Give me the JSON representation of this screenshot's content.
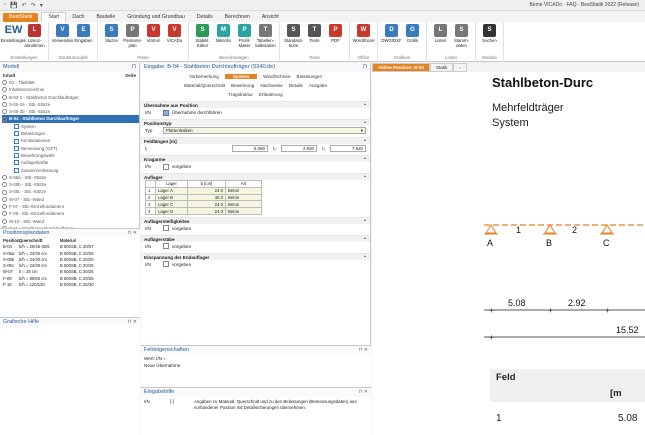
{
  "window": {
    "title": "Beme VICADo · FAQ · BestStatik 2022 (Release)",
    "quick_access": [
      "▫",
      "💾",
      "↶",
      "↷",
      "▾"
    ]
  },
  "tabs": [
    {
      "label": "BestStatik",
      "kind": "file"
    },
    {
      "label": "Start",
      "kind": "active"
    },
    {
      "label": "Dach",
      "kind": ""
    },
    {
      "label": "Bauteile",
      "kind": ""
    },
    {
      "label": "Gründung und Grundbau",
      "kind": ""
    },
    {
      "label": "Details",
      "kind": ""
    },
    {
      "label": "Berechnen",
      "kind": ""
    },
    {
      "label": "Ansicht",
      "kind": ""
    }
  ],
  "ribbon": {
    "groups": [
      {
        "label": "Einstellungen",
        "buttons": [
          {
            "label": "Einstellungen",
            "icon": "ew-logo-icon",
            "color": "#1e5b9a"
          },
          {
            "label": "Lizenz-annahmen",
            "icon": "license-icon",
            "color": "#b33"
          }
        ]
      },
      {
        "label": "Strukturmodell",
        "buttons": [
          {
            "label": "Verwenden",
            "icon": "use-icon",
            "color": "#3a7bbf"
          },
          {
            "label": "Eingaben",
            "icon": "input-icon",
            "color": "#3a7bbf"
          }
        ]
      },
      {
        "label": "Pläne",
        "buttons": [
          {
            "label": "Skizze",
            "icon": "sketch-icon",
            "color": "#3a7bbf"
          },
          {
            "label": "Positions-plan",
            "icon": "position-plan-icon",
            "color": "#777"
          },
          {
            "label": "ViaXon",
            "icon": "viaxon-icon",
            "color": "#c9382c"
          },
          {
            "label": "ViCADo",
            "icon": "vicado-icon",
            "color": "#c9382c"
          }
        ]
      },
      {
        "label": "Berechnungen",
        "buttons": [
          {
            "label": "Stabilit. Editor",
            "icon": "stability-icon",
            "color": "#2e9a57"
          },
          {
            "label": "Mikrofin",
            "icon": "microfin-icon",
            "color": "#2aa3a3"
          },
          {
            "label": "Profil-Maker",
            "icon": "profile-icon",
            "color": "#2aa3a3"
          },
          {
            "label": "Tabellen-kalkulation",
            "icon": "table-icon",
            "color": "#777"
          }
        ]
      },
      {
        "label": "Texte",
        "buttons": [
          {
            "label": "Standard-texte",
            "icon": "text-icon",
            "color": "#555"
          },
          {
            "label": "Texte",
            "icon": "texts-icon",
            "color": "#555"
          },
          {
            "label": "PDF",
            "icon": "pdf-icon",
            "color": "#c9382c"
          }
        ]
      },
      {
        "label": "Office",
        "buttons": [
          {
            "label": "Word/Excel",
            "icon": "word-icon",
            "color": "#c9382c"
          }
        ]
      },
      {
        "label": "Grafiken",
        "buttons": [
          {
            "label": "DWG/DXF",
            "icon": "dwg-icon",
            "color": "#3a7bbf"
          },
          {
            "label": "Grafik",
            "icon": "graphic-icon",
            "color": "#3a7bbf"
          }
        ]
      },
      {
        "label": "Listen",
        "buttons": [
          {
            "label": "Listen",
            "icon": "list-icon",
            "color": "#777"
          },
          {
            "label": "Stamm-daten",
            "icon": "master-data-icon",
            "color": "#777"
          }
        ]
      },
      {
        "label": "Module",
        "buttons": [
          {
            "label": "Suchen",
            "icon": "binoculars-icon",
            "color": "#333"
          }
        ]
      }
    ]
  },
  "model_panel": {
    "title": "Modell",
    "col_inhalt": "Inhalt",
    "col_seite": "Seite",
    "items": [
      {
        "label": "S1 - Titelblatt",
        "kind": ""
      },
      {
        "label": "Inhaltsverzeichnis",
        "kind": ""
      },
      {
        "label": "B-03-1 - Stahlbeton Durchlaufträger",
        "kind": ""
      },
      {
        "label": "S-05-2a - Stb.-Stütze",
        "kind": ""
      },
      {
        "label": "S-05-2b - Stb.-Stütze",
        "kind": ""
      },
      {
        "label": "B-04 - Stahlbeton Durchlaufträger",
        "kind": "sel"
      },
      {
        "label": "System",
        "kind": "child"
      },
      {
        "label": "Belastungen",
        "kind": "child"
      },
      {
        "label": "Kombinationen",
        "kind": "child"
      },
      {
        "label": "Bemessung (GZT)",
        "kind": "child"
      },
      {
        "label": "Bewehrungswahl",
        "kind": "child"
      },
      {
        "label": "Auflagerkräfte",
        "kind": "child"
      },
      {
        "label": "Zusammenfassung",
        "kind": "child"
      },
      {
        "label": "S-05a - Stb.-Stütze",
        "kind": ""
      },
      {
        "label": "S-05b - Stb.-Stütze",
        "kind": ""
      },
      {
        "label": "S-05c - Stb.-Stütze",
        "kind": ""
      },
      {
        "label": "W-07 - Stb.-Wand",
        "kind": ""
      },
      {
        "label": "F-07 - Stb.-Einzelfundament",
        "kind": ""
      },
      {
        "label": "F-09 - Stb.-Einzelfundament",
        "kind": ""
      },
      {
        "label": "W-10 - Stb.-Wand",
        "kind": ""
      },
      {
        "label": "B-11 - Stahlbeton Durchlaufträger",
        "kind": ""
      },
      {
        "label": "F-16 - Stb.-Einzelfundament",
        "kind": ""
      },
      {
        "label": "S-10-1 - Stb.-Stütze",
        "kind": ""
      },
      {
        "label": "S-12-1 - Stb.-Stütze",
        "kind": ""
      }
    ]
  },
  "positions_panel": {
    "title": "Positionsplandaten",
    "headers": [
      "Position",
      "Querschnitt",
      "Material"
    ],
    "rows": [
      [
        "B-04",
        "b/h = 20/45-30/6",
        "B 500SB, C 30/37"
      ],
      [
        "S-05a",
        "b/h = 24/30 cm",
        "B 500SB, C 20/25"
      ],
      [
        "S-05b",
        "b/h = 24/30 cm",
        "B 500SB, C 20/25"
      ],
      [
        "S-05c",
        "b/h = 24/30 cm",
        "B 500SB, C 20/25"
      ],
      [
        "W-07",
        "h = 25 cm",
        "B 500SB, C 20/25"
      ],
      [
        "F-09",
        "b/h = 80/60 cm",
        "B 500SB, C 20/25"
      ],
      [
        "F-16",
        "b/h = 120/120",
        "B 500SB, C 25/30"
      ]
    ]
  },
  "graphics_help": {
    "title": "Grafische Hilfe"
  },
  "input_panel": {
    "title": "Eingabe: B-04 - Stahlbeton Durchlaufträger (S340.de)",
    "tabs_row1": [
      "Vorbemerkung",
      "System",
      "Wind/Schnee",
      "Belastungen"
    ],
    "tabs_row2": [
      "Material/Querschnitt",
      "Bewehrung",
      "Nachweise",
      "Details",
      "Ausgabe"
    ],
    "tabs_row3": [
      "Tragstruktur",
      "Erläuterung"
    ],
    "sections": {
      "uebernahme": "Übernahme aus Position",
      "uebernahme_label": "I/N",
      "uebernahme_check": "Übernahme durchführen",
      "positionstyp": "Positionstyp",
      "typ_label": "Typ",
      "typ_value": "Plattenbalken",
      "feldlaengen": "Feldlängen [m]",
      "l1_label": "l₁",
      "l1": "5.080",
      "l2_label": "l₂",
      "l2": "2.920",
      "l3_label": "l₃",
      "l3": "7.520",
      "kragarme": "Kragarme",
      "kragarme_check": "vorgeben",
      "auflager": "Auflager",
      "lager_headers": [
        "",
        "Lager",
        "b [cm]",
        "Art"
      ],
      "lager_rows": [
        [
          "1",
          "Lager A",
          "24.0",
          "Beton"
        ],
        [
          "2",
          "Lager B",
          "40.0",
          "Beton"
        ],
        [
          "3",
          "Lager C",
          "24.0",
          "Beton"
        ],
        [
          "4",
          "Lager D",
          "24.0",
          "Beton"
        ]
      ],
      "auflagersteif": "Auflagersteifigkeiten",
      "auflagerstaebe": "Auflagerstäbe",
      "einspannung": "Einspannung der Endauflager",
      "check_label": "vorgeben",
      "in_label": "I/N"
    }
  },
  "field_props": {
    "title": "Feldeigenschaften",
    "line1": "Wert: I/N =",
    "line2": "Neue Übernahme"
  },
  "input_help": {
    "title": "Eingabehilfe",
    "key": "I/N",
    "range": "[-]",
    "text": "Angaben zu Material, Querschnitt und zu den Belastungen (Bemessungsdaten) aus vorhandener Position mit Detailsicherungen übernehmen."
  },
  "doc_view": {
    "tabs": [
      "Aktive Position: B-04",
      "Statik"
    ],
    "header": "Stahlbeton-Durc",
    "subtitle1": "Mehrfeldträger",
    "subtitle2": "System",
    "supports": [
      "A",
      "B",
      "C"
    ],
    "spans": [
      "1",
      "2"
    ],
    "dims": [
      "5.08",
      "2.92",
      "15.52"
    ],
    "feld_label": "Feld",
    "feld_unit": "[m",
    "row1": "1",
    "row1_val": "5.08",
    "accent": "#e2831f"
  }
}
